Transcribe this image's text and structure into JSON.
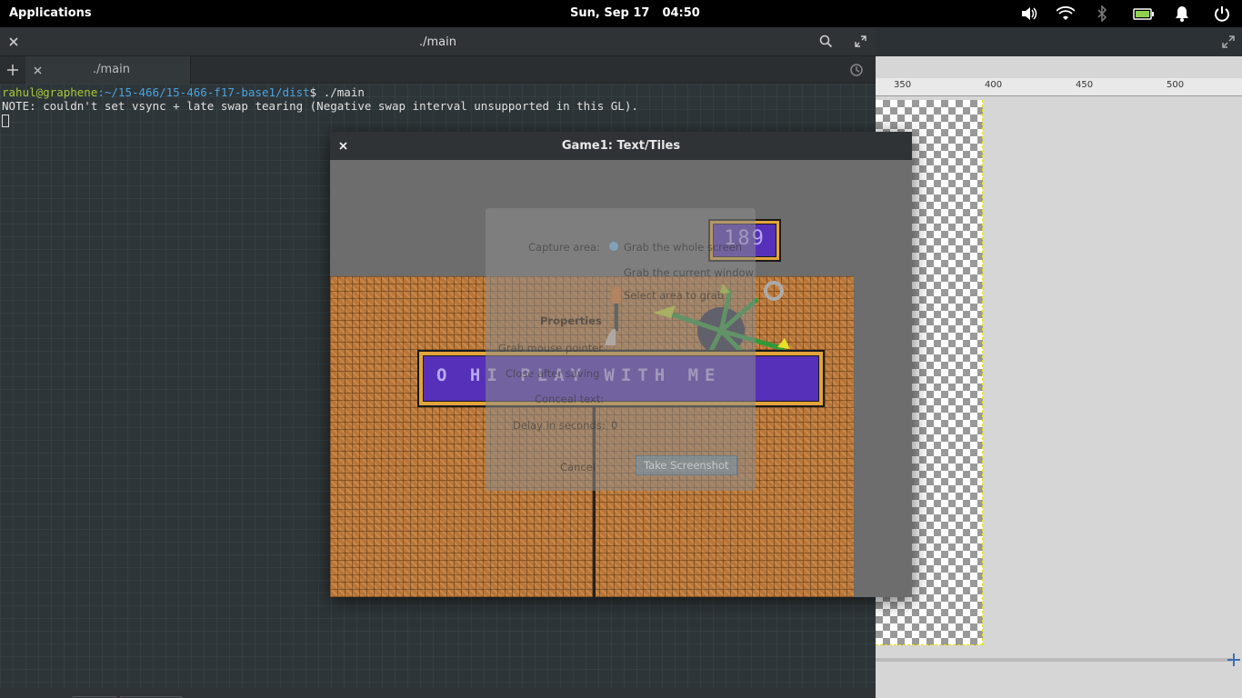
{
  "panel": {
    "applications": "Applications",
    "date": "Sun, Sep 17",
    "time": "04:50",
    "tray_icons": [
      "volume-icon",
      "wifi-icon",
      "bluetooth-icon",
      "battery-icon",
      "notification-icon",
      "power-icon"
    ]
  },
  "terminal": {
    "window_title": "./main",
    "tab_title": "./main",
    "prompt_user": "rahul@graphene",
    "prompt_path": ":~/15-466/15-466-f17-base1/dist",
    "prompt_symbol": "$ ",
    "command": "./main",
    "output_line": "NOTE: couldn't set vsync + late swap tearing (Negative swap interval unsupported in this GL)."
  },
  "gimp": {
    "ruler_ticks": [
      "350",
      "400",
      "450",
      "500"
    ]
  },
  "game": {
    "window_title": "Game1: Text/Tiles",
    "score": "189",
    "message": "O HI PLAY WITH ME"
  },
  "screenshot_dialog": {
    "capture_area_label": "Capture area:",
    "option_whole_screen": "Grab the whole screen",
    "option_current_window": "Grab the current window",
    "option_select_area": "Select area to grab",
    "properties_label": "Properties",
    "grab_pointer": "Grab mouse pointer",
    "close_after_saving": "Close after saving",
    "conceal_text": "Conceal text:",
    "delay_label": "Delay in seconds:",
    "delay_value": "0",
    "cancel": "Cancel",
    "take_screenshot": "Take Screenshot"
  },
  "colors": {
    "terminal_bg": "#2e3538",
    "prompt_user": "#a5c73c",
    "prompt_path": "#4aa3df",
    "panel_bg": "#000000",
    "floor": "#b8763a",
    "text_box": "#5630b8",
    "text_box_border": "#e2a43b"
  }
}
